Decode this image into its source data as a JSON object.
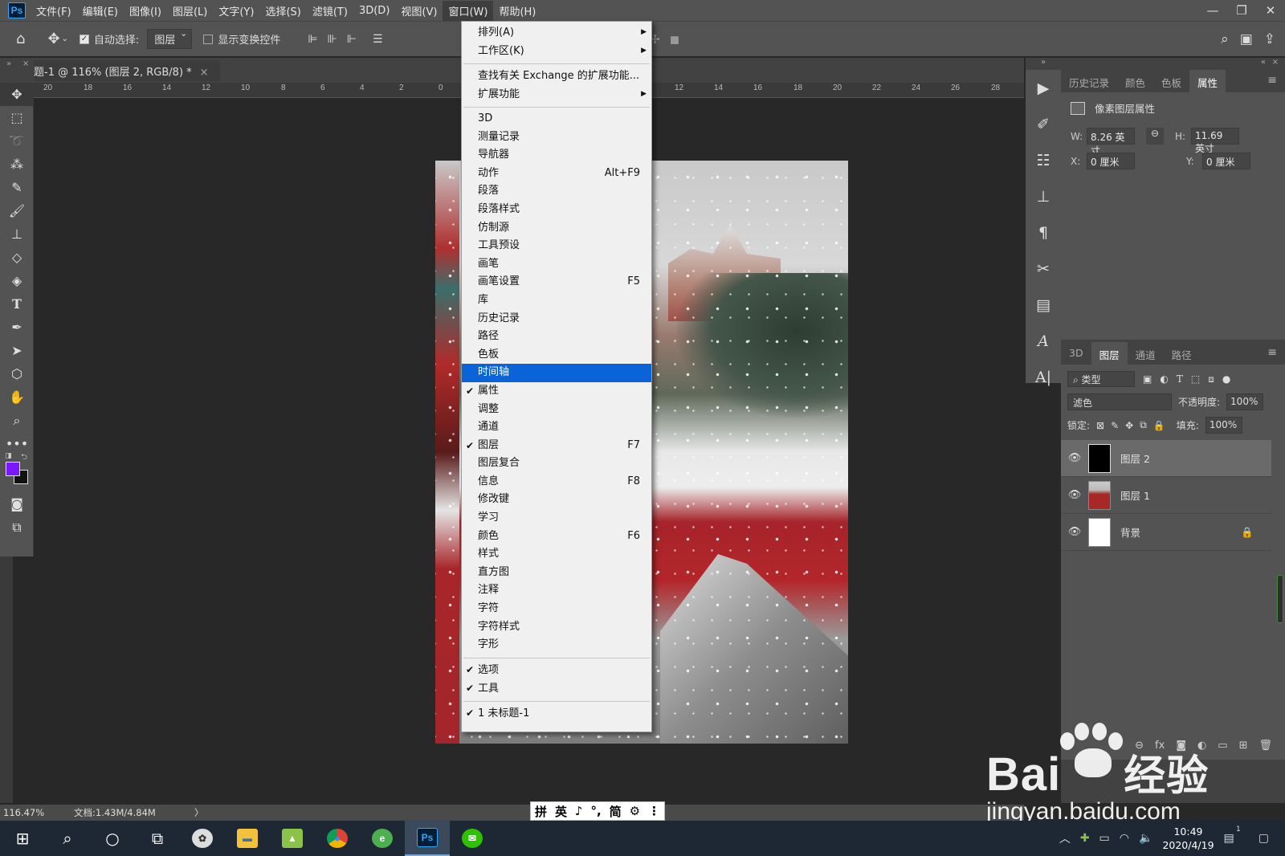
{
  "app": {
    "logo": "Ps"
  },
  "menubar": {
    "items": [
      "文件(F)",
      "编辑(E)",
      "图像(I)",
      "图层(L)",
      "文字(Y)",
      "选择(S)",
      "滤镜(T)",
      "3D(D)",
      "视图(V)",
      "窗口(W)",
      "帮助(H)"
    ],
    "open_index": 9
  },
  "window_controls": {
    "minimize": "—",
    "restore": "❐",
    "close": "✕"
  },
  "options_bar": {
    "auto_select_label": "自动选择:",
    "auto_select_checked": true,
    "target_value": "图层",
    "show_transform_label": "显示变换控件",
    "show_transform_checked": false
  },
  "document_tab": {
    "title": "题-1 @ 116% (图层 2, RGB/8) *",
    "close": "×"
  },
  "ruler_top": {
    "ticks": [
      "20",
      "18",
      "16",
      "14",
      "12",
      "10",
      "8",
      "6",
      "4",
      "2",
      "0",
      "12",
      "14",
      "16",
      "18",
      "20",
      "22",
      "24",
      "26",
      "28"
    ]
  },
  "window_menu": {
    "arrange": "排列(A)",
    "workspace": "工作区(K)",
    "find_exchange": "查找有关 Exchange 的扩展功能...",
    "extensions": "扩展功能",
    "items": [
      {
        "label": "3D",
        "shortcut": "",
        "checked": false
      },
      {
        "label": "测量记录",
        "shortcut": "",
        "checked": false
      },
      {
        "label": "导航器",
        "shortcut": "",
        "checked": false
      },
      {
        "label": "动作",
        "shortcut": "Alt+F9",
        "checked": false
      },
      {
        "label": "段落",
        "shortcut": "",
        "checked": false
      },
      {
        "label": "段落样式",
        "shortcut": "",
        "checked": false
      },
      {
        "label": "仿制源",
        "shortcut": "",
        "checked": false
      },
      {
        "label": "工具预设",
        "shortcut": "",
        "checked": false
      },
      {
        "label": "画笔",
        "shortcut": "",
        "checked": false
      },
      {
        "label": "画笔设置",
        "shortcut": "F5",
        "checked": false
      },
      {
        "label": "库",
        "shortcut": "",
        "checked": false
      },
      {
        "label": "历史记录",
        "shortcut": "",
        "checked": false
      },
      {
        "label": "路径",
        "shortcut": "",
        "checked": false
      },
      {
        "label": "色板",
        "shortcut": "",
        "checked": false
      },
      {
        "label": "时间轴",
        "shortcut": "",
        "checked": false,
        "highlighted": true
      },
      {
        "label": "属性",
        "shortcut": "",
        "checked": true
      },
      {
        "label": "调整",
        "shortcut": "",
        "checked": false
      },
      {
        "label": "通道",
        "shortcut": "",
        "checked": false
      },
      {
        "label": "图层",
        "shortcut": "F7",
        "checked": true
      },
      {
        "label": "图层复合",
        "shortcut": "",
        "checked": false
      },
      {
        "label": "信息",
        "shortcut": "F8",
        "checked": false
      },
      {
        "label": "修改键",
        "shortcut": "",
        "checked": false
      },
      {
        "label": "学习",
        "shortcut": "",
        "checked": false
      },
      {
        "label": "颜色",
        "shortcut": "F6",
        "checked": false
      },
      {
        "label": "样式",
        "shortcut": "",
        "checked": false
      },
      {
        "label": "直方图",
        "shortcut": "",
        "checked": false
      },
      {
        "label": "注释",
        "shortcut": "",
        "checked": false
      },
      {
        "label": "字符",
        "shortcut": "",
        "checked": false
      },
      {
        "label": "字符样式",
        "shortcut": "",
        "checked": false
      },
      {
        "label": "字形",
        "shortcut": "",
        "checked": false
      }
    ],
    "options": "选项",
    "tools": "工具",
    "doc": "1 未标题-1",
    "check_mark": "✔",
    "submenu_arrow": "▶"
  },
  "properties_panel": {
    "tabs": [
      "历史记录",
      "颜色",
      "色板",
      "属性"
    ],
    "active_tab": 3,
    "subtitle": "像素图层属性",
    "w_label": "W:",
    "w_value": "8.26 英寸",
    "h_label": "H:",
    "h_value": "11.69 英寸",
    "x_label": "X:",
    "x_value": "0 厘米",
    "y_label": "Y:",
    "y_value": "0 厘米",
    "menu": "≡"
  },
  "layers_panel": {
    "tabs": [
      "3D",
      "图层",
      "通道",
      "路径"
    ],
    "active_tab": 1,
    "filter_label": "类型",
    "blend_mode": "滤色",
    "opacity_label": "不透明度:",
    "opacity_value": "100%",
    "lock_label": "锁定:",
    "fill_label": "填充:",
    "fill_value": "100%",
    "layers": [
      {
        "name": "图层 2",
        "selected": true,
        "locked": false
      },
      {
        "name": "图层 1",
        "selected": false,
        "locked": false
      },
      {
        "name": "背景",
        "selected": false,
        "locked": true
      }
    ],
    "footer_fx": "fx"
  },
  "status_bar": {
    "zoom": "116.47%",
    "doc_size": "文档:1.43M/4.84M",
    "arrow": "〉"
  },
  "ime_bar": [
    "拼",
    "英",
    "♪",
    "°,",
    "简",
    "⚙",
    "⋮"
  ],
  "taskbar": {
    "clock_time": "10:49",
    "clock_date": "2020/4/19",
    "notification_count": "1"
  },
  "watermark": {
    "brand": "Bai",
    "brand_cn": "经验",
    "url": "jingyan.baidu.com"
  },
  "colors": {
    "foreground": "#7b17ff",
    "background": "#111111",
    "highlight": "#0a64d8"
  }
}
